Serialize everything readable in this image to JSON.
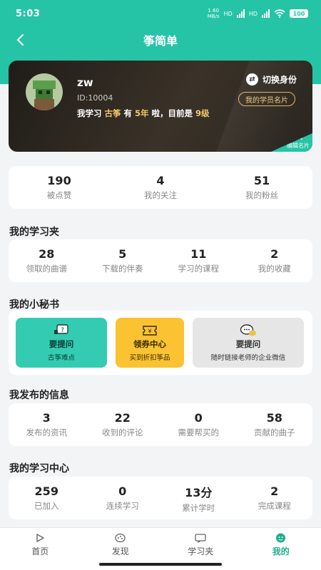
{
  "status_bar": {
    "time": "5:03",
    "speed_value": "1.60",
    "speed_unit": "MB/s",
    "network_1": "HD",
    "network_2": "HD",
    "battery": "100"
  },
  "nav": {
    "title": "筝简单",
    "back_icon": "chevron-left-icon"
  },
  "profile": {
    "username": "zw",
    "id_text": "ID:10004",
    "desc_prefix": "我学习",
    "desc_instrument": "古筝",
    "desc_mid": "有",
    "desc_years": "5年",
    "desc_mid2": "啦，目前是",
    "desc_level": "9级",
    "switch_label": "切换身份",
    "member_card_label": "我的学员名片",
    "edit_card_label": "编辑名片"
  },
  "social_stats": [
    {
      "value": "190",
      "label": "被点赞"
    },
    {
      "value": "4",
      "label": "我的关注"
    },
    {
      "value": "51",
      "label": "我的粉丝"
    }
  ],
  "study_folder": {
    "title": "我的学习夹",
    "items": [
      {
        "value": "28",
        "label": "领取的曲谱"
      },
      {
        "value": "5",
        "label": "下载的伴奏"
      },
      {
        "value": "11",
        "label": "学习的课程"
      },
      {
        "value": "2",
        "label": "我的收藏"
      }
    ]
  },
  "secretary": {
    "title": "我的小秘书",
    "tiles": [
      {
        "title": "要提问",
        "sub": "古筝难点",
        "icon": "question-chat-icon"
      },
      {
        "title": "领券中心",
        "sub": "买到折扣筝品",
        "icon": "coupon-icon"
      },
      {
        "title": "要提问",
        "sub": "随时链接老师的企业微信",
        "icon": "wechat-chat-icon"
      }
    ]
  },
  "published": {
    "title": "我发布的信息",
    "items": [
      {
        "value": "3",
        "label": "发布的资讯"
      },
      {
        "value": "22",
        "label": "收到的评论"
      },
      {
        "value": "0",
        "label": "需要帮买的"
      },
      {
        "value": "58",
        "label": "贡献的曲子"
      }
    ]
  },
  "learning_center": {
    "title": "我的学习中心",
    "items": [
      {
        "value": "259",
        "label": "已加入"
      },
      {
        "value": "0",
        "label": "连续学习"
      },
      {
        "value": "13分",
        "label": "累计学时"
      },
      {
        "value": "2",
        "label": "完成课程"
      }
    ]
  },
  "tabbar": [
    {
      "label": "首页",
      "icon": "play-icon",
      "active": false
    },
    {
      "label": "发现",
      "icon": "discover-icon",
      "active": false
    },
    {
      "label": "学习夹",
      "icon": "folder-chat-icon",
      "active": false
    },
    {
      "label": "我的",
      "icon": "profile-icon",
      "active": true
    }
  ],
  "colors": {
    "brand": "#26c4a6",
    "tile_teal": "#33ccb2",
    "tile_yellow": "#fbc232",
    "tile_gray": "#e6e6e6",
    "gold": "#f3c66b"
  }
}
